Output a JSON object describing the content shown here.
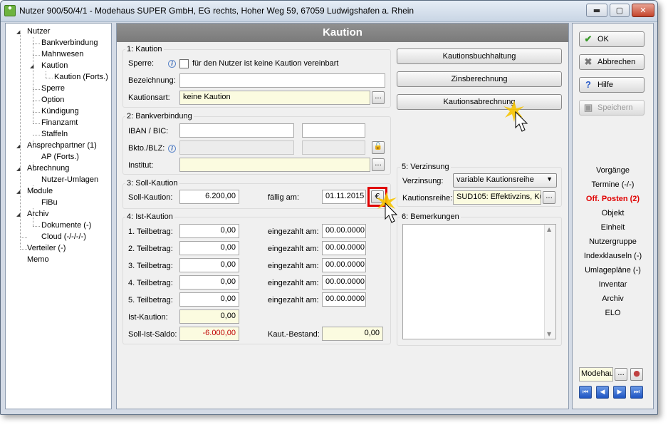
{
  "window": {
    "title": "Nutzer 900/50/4/1 - Modehaus SUPER GmbH, EG rechts, Hoher Weg 59, 67059 Ludwigshafen a. Rhein",
    "controls": {
      "minimize": "▬",
      "maximize": "▢",
      "close": "✕"
    }
  },
  "tree": {
    "items": [
      {
        "label": "Nutzer"
      },
      {
        "label": "Bankverbindung"
      },
      {
        "label": "Mahnwesen"
      },
      {
        "label": "Kaution"
      },
      {
        "label": "Kaution (Forts.)"
      },
      {
        "label": "Sperre"
      },
      {
        "label": "Option"
      },
      {
        "label": "Kündigung"
      },
      {
        "label": "Finanzamt"
      },
      {
        "label": "Staffeln"
      },
      {
        "label": "Ansprechpartner (1)"
      },
      {
        "label": "AP (Forts.)"
      },
      {
        "label": "Abrechnung"
      },
      {
        "label": "Nutzer-Umlagen"
      },
      {
        "label": "Module"
      },
      {
        "label": "FiBu"
      },
      {
        "label": "Archiv"
      },
      {
        "label": "Dokumente (-)"
      },
      {
        "label": "Cloud (-/-/-/-)"
      },
      {
        "label": "Verteiler (-)"
      },
      {
        "label": "Memo"
      }
    ]
  },
  "main": {
    "header": "Kaution",
    "kaution": {
      "group_label": "1: Kaution",
      "sperre_label": "Sperre:",
      "sperre_checkbox_label": "für den Nutzer ist keine Kaution vereinbart",
      "bezeichnung_label": "Bezeichnung:",
      "bezeichnung_value": "",
      "kautionsart_label": "Kautionsart:",
      "kautionsart_value": "keine Kaution",
      "dots": "..."
    },
    "bank": {
      "group_label": "2: Bankverbindung",
      "iban_label": "IBAN / BIC:",
      "blz_label": "Bkto./BLZ:",
      "institut_label": "Institut:"
    },
    "soll": {
      "group_label": "3: Soll-Kaution",
      "soll_label": "Soll-Kaution:",
      "soll_value": "6.200,00",
      "faellig_label": "fällig am:",
      "faellig_value": "01.11.2015",
      "euro": "€"
    },
    "ist": {
      "group_label": "4: Ist-Kaution",
      "rows": [
        {
          "label": "1. Teilbetrag:",
          "value": "0,00",
          "paid_label": "eingezahlt am:",
          "paid_value": "00.00.0000"
        },
        {
          "label": "2. Teilbetrag:",
          "value": "0,00",
          "paid_label": "eingezahlt am:",
          "paid_value": "00.00.0000"
        },
        {
          "label": "3. Teilbetrag:",
          "value": "0,00",
          "paid_label": "eingezahlt am:",
          "paid_value": "00.00.0000"
        },
        {
          "label": "4. Teilbetrag:",
          "value": "0,00",
          "paid_label": "eingezahlt am:",
          "paid_value": "00.00.0000"
        },
        {
          "label": "5. Teilbetrag:",
          "value": "0,00",
          "paid_label": "eingezahlt am:",
          "paid_value": "00.00.0000"
        }
      ],
      "ist_label": "Ist-Kaution:",
      "ist_value": "0,00",
      "saldo_label": "Soll-Ist-Saldo:",
      "saldo_value": "-6.000,00",
      "bestand_label": "Kaut.-Bestand:",
      "bestand_value": "0,00"
    },
    "buttons": {
      "buchhaltung": "Kautionsbuchhaltung",
      "zins": "Zinsberechnung",
      "abrechnung": "Kautionsabrechnung"
    },
    "verzinsung": {
      "group_label": "5: Verzinsung",
      "verzinsung_label": "Verzinsung:",
      "verzinsung_value": "variable Kautionsreihe",
      "reihe_label": "Kautionsreihe:",
      "reihe_value": "SUD105: Effektivzins, Kü"
    },
    "bemerkungen": {
      "group_label": "6: Bemerkungen"
    }
  },
  "sidebar": {
    "ok": "OK",
    "abbrechen": "Abbrechen",
    "hilfe": "Hilfe",
    "speichern": "Speichern",
    "nav": [
      {
        "label": "Vorgänge"
      },
      {
        "label": "Termine (-/-)"
      },
      {
        "label": "Off. Posten (2)"
      },
      {
        "label": "Objekt"
      },
      {
        "label": "Einheit"
      },
      {
        "label": "Nutzergruppe"
      },
      {
        "label": "Indexklauseln (-)"
      },
      {
        "label": "Umlagepläne (-)"
      },
      {
        "label": "Inventar"
      },
      {
        "label": "Archiv"
      },
      {
        "label": "ELO"
      }
    ],
    "mandant_value": "Modehaus",
    "colors": {
      "highlight": "#e00000",
      "nav_blue": "#1f55c2"
    }
  }
}
